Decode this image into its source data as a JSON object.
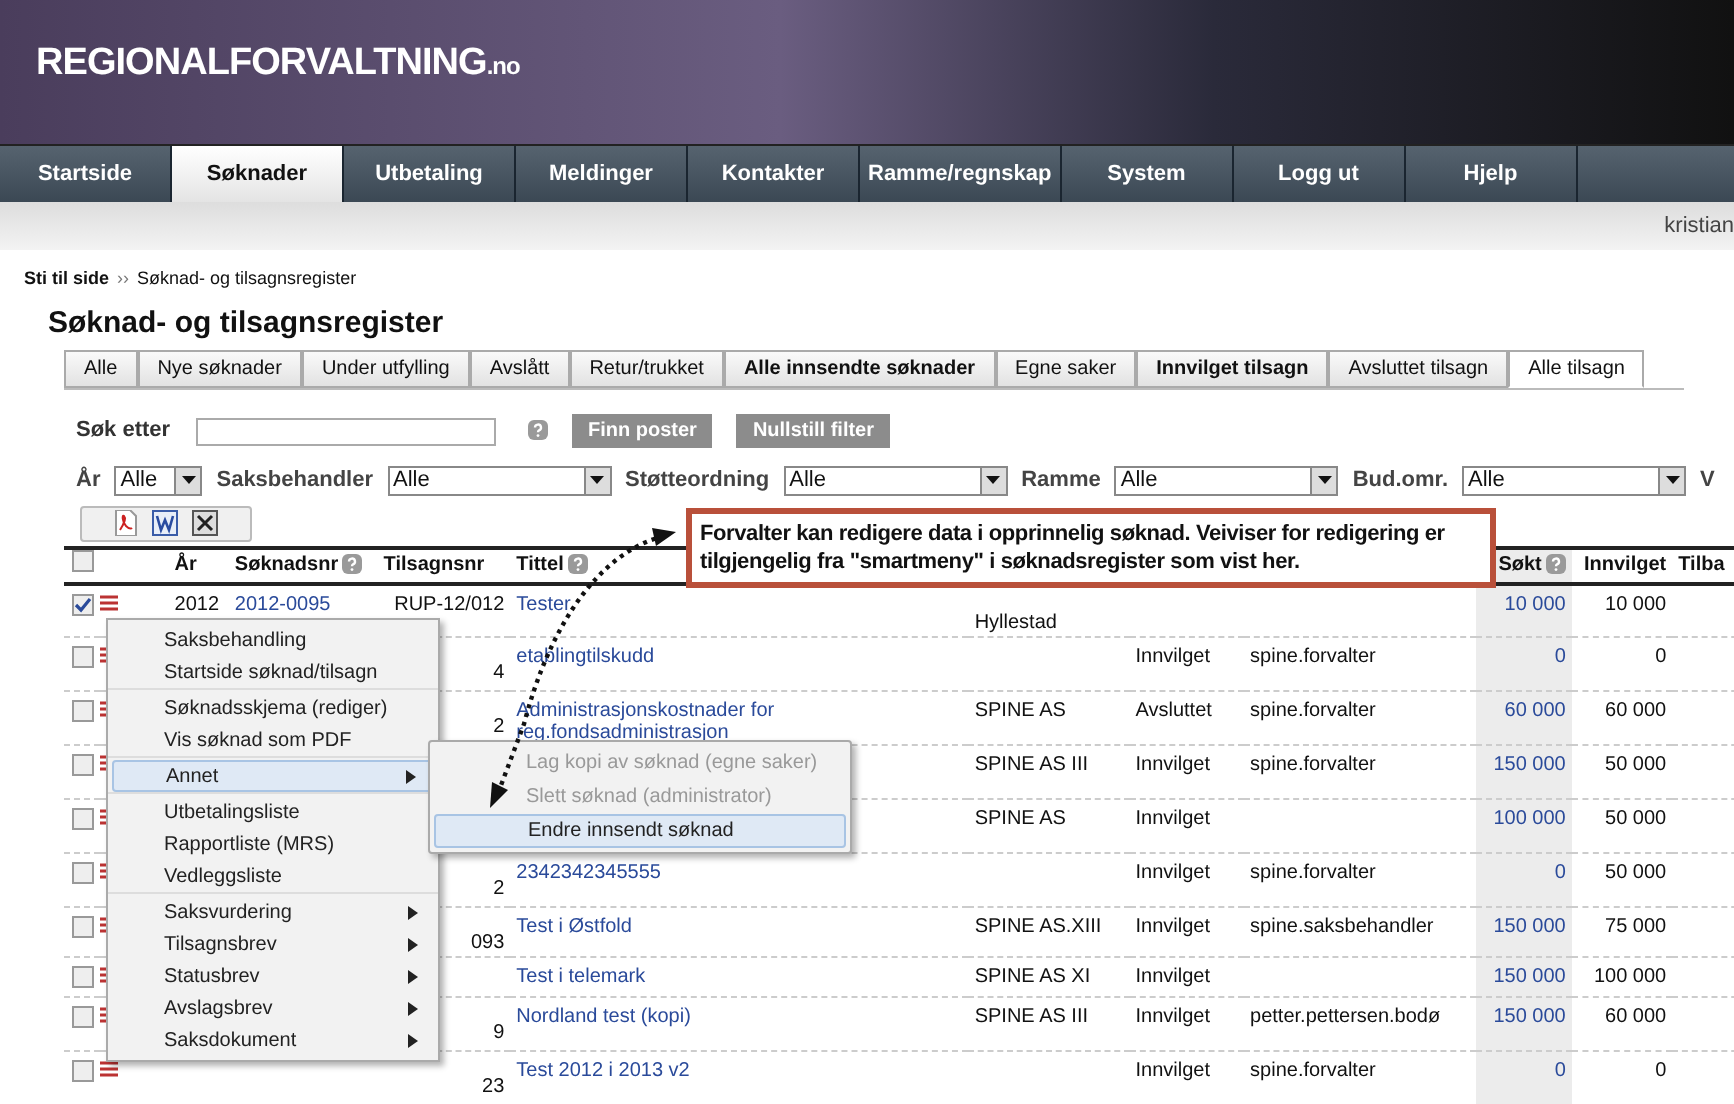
{
  "site": {
    "logo": "REGIONALFORVALTNING",
    "logo_suffix": ".no"
  },
  "nav": [
    {
      "label": "Startside",
      "selected": false
    },
    {
      "label": "Søknader",
      "selected": true
    },
    {
      "label": "Utbetaling",
      "selected": false
    },
    {
      "label": "Meldinger",
      "selected": false
    },
    {
      "label": "Kontakter",
      "selected": false
    },
    {
      "label": "Ramme/regnskap",
      "selected": false
    },
    {
      "label": "System",
      "selected": false
    },
    {
      "label": "Logg ut",
      "selected": false
    },
    {
      "label": "Hjelp",
      "selected": false
    }
  ],
  "user": "kristian",
  "breadcrumb": {
    "label": "Sti til side",
    "separator": "››",
    "current": "Søknad- og tilsagnsregister"
  },
  "title": "Søknad- og tilsagnsregister",
  "tabs": [
    {
      "label": "Alle",
      "selected": false,
      "bold": false
    },
    {
      "label": "Nye søknader",
      "selected": false,
      "bold": false
    },
    {
      "label": "Under utfylling",
      "selected": false,
      "bold": false
    },
    {
      "label": "Avslått",
      "selected": false,
      "bold": false
    },
    {
      "label": "Retur/trukket",
      "selected": false,
      "bold": false
    },
    {
      "label": "Alle innsendte søknader",
      "selected": false,
      "bold": true
    },
    {
      "label": "Egne saker",
      "selected": false,
      "bold": false
    },
    {
      "label": "Innvilget tilsagn",
      "selected": false,
      "bold": true
    },
    {
      "label": "Avsluttet tilsagn",
      "selected": false,
      "bold": false
    },
    {
      "label": "Alle tilsagn",
      "selected": true,
      "bold": false
    }
  ],
  "search": {
    "label": "Søk etter",
    "buttons": [
      "Finn poster",
      "Nullstill filter"
    ]
  },
  "filters": [
    {
      "label": "År",
      "value": "Alle"
    },
    {
      "label": "Saksbehandler",
      "value": "Alle"
    },
    {
      "label": "Støtteordning",
      "value": "Alle"
    },
    {
      "label": "Ramme",
      "value": "Alle"
    },
    {
      "label": "Bud.omr.",
      "value": "Alle"
    },
    {
      "label": "V"
    }
  ],
  "table": {
    "select_all": {
      "checked": false
    },
    "columns": [
      "År",
      "Søknadsnr",
      "Tilsagnsnr",
      "Tittel",
      "",
      "",
      "",
      "Søkt",
      "Innvilget",
      "Tilba"
    ],
    "rows": [
      {
        "checked": true,
        "year": "2012",
        "soknadsnr": "2012-0095",
        "tilsagnsnr": "RUP-12/012",
        "title": "Tester",
        "org": "Hyllestad",
        "status": "",
        "handler": "",
        "sokt": "10 000",
        "innvilget": "10 000"
      },
      {
        "checked": false,
        "tilsagnsnr": "4",
        "title": "etablingtilskudd",
        "org": "",
        "status": "Innvilget",
        "handler": "spine.forvalter",
        "sokt": "0",
        "innvilget": "0"
      },
      {
        "checked": false,
        "tilsagnsnr": "2",
        "title": "Administrasjonskostnader for reg.fondsadministrasjon",
        "org": "SPINE AS",
        "status": "Avsluttet",
        "handler": "spine.forvalter",
        "sokt": "60 000",
        "innvilget": "60 000"
      },
      {
        "checked": false,
        "tilsagnsnr": "",
        "title": "",
        "org": "SPINE AS III",
        "status": "Innvilget",
        "handler": "spine.forvalter",
        "sokt": "150 000",
        "innvilget": "50 000"
      },
      {
        "checked": false,
        "tilsagnsnr": "",
        "title": "",
        "org": "SPINE AS",
        "status": "Innvilget",
        "handler": "",
        "sokt": "100 000",
        "innvilget": "50 000"
      },
      {
        "checked": false,
        "tilsagnsnr": "2",
        "title": "2342342345555",
        "org": "",
        "status": "Innvilget",
        "handler": "spine.forvalter",
        "sokt": "0",
        "innvilget": "50 000"
      },
      {
        "checked": false,
        "tilsagnsnr": "093",
        "title": "Test i Østfold",
        "org": "SPINE AS.XIII",
        "status": "Innvilget",
        "handler": "spine.saksbehandler",
        "sokt": "150 000",
        "innvilget": "75 000"
      },
      {
        "checked": false,
        "tilsagnsnr": "",
        "title": "Test i telemark",
        "org": "SPINE AS XI",
        "status": "Innvilget",
        "handler": "",
        "sokt": "150 000",
        "innvilget": "100 000"
      },
      {
        "checked": false,
        "tilsagnsnr": "9",
        "title": "Nordland test (kopi)",
        "org": "SPINE AS III",
        "status": "Innvilget",
        "handler": "petter.pettersen.bodø",
        "sokt": "150 000",
        "innvilget": "60 000"
      },
      {
        "checked": false,
        "tilsagnsnr": "23",
        "title": "Test 2012 i 2013 v2",
        "org": "",
        "status": "Innvilget",
        "handler": "spine.forvalter",
        "sokt": "0",
        "innvilget": "0"
      }
    ]
  },
  "context_menu": {
    "groups": [
      [
        {
          "label": "Saksbehandling",
          "submenu": false,
          "selected": false
        },
        {
          "label": "Startside søknad/tilsagn",
          "submenu": false,
          "selected": false
        }
      ],
      [
        {
          "label": "Søknadsskjema (rediger)",
          "submenu": false,
          "selected": false
        },
        {
          "label": "Vis søknad som PDF",
          "submenu": false,
          "selected": false
        }
      ],
      [
        {
          "label": "Annet",
          "submenu": true,
          "selected": true
        }
      ],
      [
        {
          "label": "Utbetalingsliste",
          "submenu": false,
          "selected": false
        },
        {
          "label": "Rapportliste (MRS)",
          "submenu": false,
          "selected": false
        },
        {
          "label": "Vedleggsliste",
          "submenu": false,
          "selected": false
        }
      ],
      [
        {
          "label": "Saksvurdering",
          "submenu": true,
          "selected": false
        },
        {
          "label": "Tilsagnsbrev",
          "submenu": true,
          "selected": false
        },
        {
          "label": "Statusbrev",
          "submenu": true,
          "selected": false
        },
        {
          "label": "Avslagsbrev",
          "submenu": true,
          "selected": false
        },
        {
          "label": "Saksdokument",
          "submenu": true,
          "selected": false
        }
      ]
    ]
  },
  "submenu": [
    {
      "label": "Lag kopi av søknad (egne saker)",
      "disabled": true,
      "selected": false
    },
    {
      "label": "Slett søknad (administrator)",
      "disabled": true,
      "selected": false
    },
    {
      "label": "Endre innsendt søknad",
      "disabled": false,
      "selected": true
    }
  ],
  "callout": "Forvalter kan redigere data i opprinnelig søknad. Veiviser for redigering er tilgjengelig fra \"smartmeny\" i søknadsregister som vist her."
}
